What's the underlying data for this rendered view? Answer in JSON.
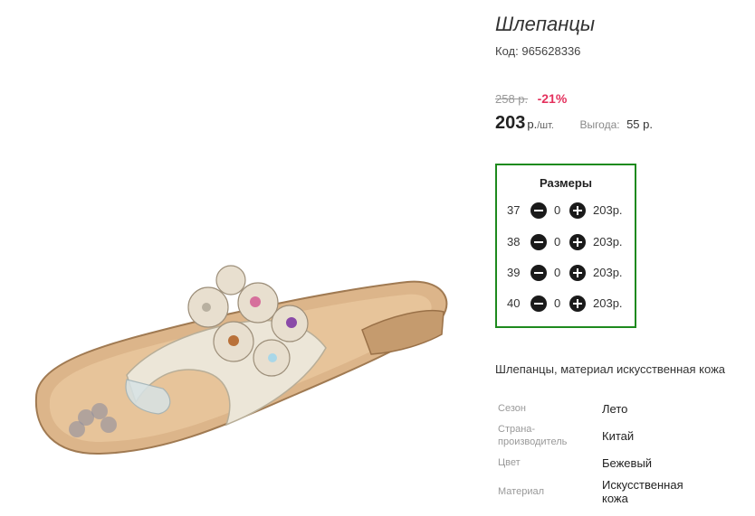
{
  "product": {
    "title": "Шлепанцы",
    "code_label": "Код:",
    "code_value": "965628336",
    "old_price": "258 р.",
    "discount": "-21%",
    "price": "203",
    "currency": "р.",
    "per_unit": "/шт.",
    "saving_label": "Выгода:",
    "saving_value": "55 р.",
    "description": "Шлепанцы, материал искусственная кожа"
  },
  "sizes": {
    "title": "Размеры",
    "rows": [
      {
        "size": "37",
        "qty": "0",
        "price": "203р."
      },
      {
        "size": "38",
        "qty": "0",
        "price": "203р."
      },
      {
        "size": "39",
        "qty": "0",
        "price": "203р."
      },
      {
        "size": "40",
        "qty": "0",
        "price": "203р."
      }
    ]
  },
  "specs": [
    {
      "label": "Сезон",
      "value": "Лето"
    },
    {
      "label": "Страна-производитель",
      "value": "Китай"
    },
    {
      "label": "Цвет",
      "value": "Бежевый"
    },
    {
      "label": "Материал",
      "value": "Искусственная кожа"
    }
  ],
  "colors": {
    "accent_border": "#1e8a1e",
    "discount": "#e4315d"
  }
}
